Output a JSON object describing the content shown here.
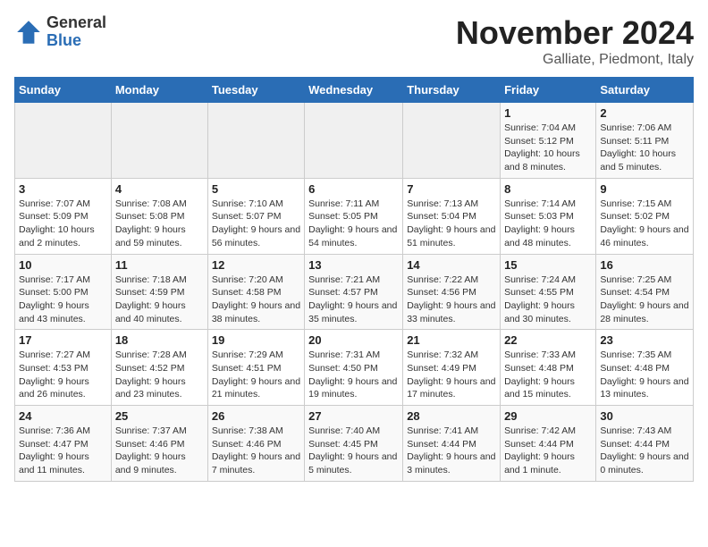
{
  "logo": {
    "general": "General",
    "blue": "Blue"
  },
  "header": {
    "month": "November 2024",
    "location": "Galliate, Piedmont, Italy"
  },
  "weekdays": [
    "Sunday",
    "Monday",
    "Tuesday",
    "Wednesday",
    "Thursday",
    "Friday",
    "Saturday"
  ],
  "weeks": [
    [
      {
        "day": "",
        "info": ""
      },
      {
        "day": "",
        "info": ""
      },
      {
        "day": "",
        "info": ""
      },
      {
        "day": "",
        "info": ""
      },
      {
        "day": "",
        "info": ""
      },
      {
        "day": "1",
        "info": "Sunrise: 7:04 AM\nSunset: 5:12 PM\nDaylight: 10 hours and 8 minutes."
      },
      {
        "day": "2",
        "info": "Sunrise: 7:06 AM\nSunset: 5:11 PM\nDaylight: 10 hours and 5 minutes."
      }
    ],
    [
      {
        "day": "3",
        "info": "Sunrise: 7:07 AM\nSunset: 5:09 PM\nDaylight: 10 hours and 2 minutes."
      },
      {
        "day": "4",
        "info": "Sunrise: 7:08 AM\nSunset: 5:08 PM\nDaylight: 9 hours and 59 minutes."
      },
      {
        "day": "5",
        "info": "Sunrise: 7:10 AM\nSunset: 5:07 PM\nDaylight: 9 hours and 56 minutes."
      },
      {
        "day": "6",
        "info": "Sunrise: 7:11 AM\nSunset: 5:05 PM\nDaylight: 9 hours and 54 minutes."
      },
      {
        "day": "7",
        "info": "Sunrise: 7:13 AM\nSunset: 5:04 PM\nDaylight: 9 hours and 51 minutes."
      },
      {
        "day": "8",
        "info": "Sunrise: 7:14 AM\nSunset: 5:03 PM\nDaylight: 9 hours and 48 minutes."
      },
      {
        "day": "9",
        "info": "Sunrise: 7:15 AM\nSunset: 5:02 PM\nDaylight: 9 hours and 46 minutes."
      }
    ],
    [
      {
        "day": "10",
        "info": "Sunrise: 7:17 AM\nSunset: 5:00 PM\nDaylight: 9 hours and 43 minutes."
      },
      {
        "day": "11",
        "info": "Sunrise: 7:18 AM\nSunset: 4:59 PM\nDaylight: 9 hours and 40 minutes."
      },
      {
        "day": "12",
        "info": "Sunrise: 7:20 AM\nSunset: 4:58 PM\nDaylight: 9 hours and 38 minutes."
      },
      {
        "day": "13",
        "info": "Sunrise: 7:21 AM\nSunset: 4:57 PM\nDaylight: 9 hours and 35 minutes."
      },
      {
        "day": "14",
        "info": "Sunrise: 7:22 AM\nSunset: 4:56 PM\nDaylight: 9 hours and 33 minutes."
      },
      {
        "day": "15",
        "info": "Sunrise: 7:24 AM\nSunset: 4:55 PM\nDaylight: 9 hours and 30 minutes."
      },
      {
        "day": "16",
        "info": "Sunrise: 7:25 AM\nSunset: 4:54 PM\nDaylight: 9 hours and 28 minutes."
      }
    ],
    [
      {
        "day": "17",
        "info": "Sunrise: 7:27 AM\nSunset: 4:53 PM\nDaylight: 9 hours and 26 minutes."
      },
      {
        "day": "18",
        "info": "Sunrise: 7:28 AM\nSunset: 4:52 PM\nDaylight: 9 hours and 23 minutes."
      },
      {
        "day": "19",
        "info": "Sunrise: 7:29 AM\nSunset: 4:51 PM\nDaylight: 9 hours and 21 minutes."
      },
      {
        "day": "20",
        "info": "Sunrise: 7:31 AM\nSunset: 4:50 PM\nDaylight: 9 hours and 19 minutes."
      },
      {
        "day": "21",
        "info": "Sunrise: 7:32 AM\nSunset: 4:49 PM\nDaylight: 9 hours and 17 minutes."
      },
      {
        "day": "22",
        "info": "Sunrise: 7:33 AM\nSunset: 4:48 PM\nDaylight: 9 hours and 15 minutes."
      },
      {
        "day": "23",
        "info": "Sunrise: 7:35 AM\nSunset: 4:48 PM\nDaylight: 9 hours and 13 minutes."
      }
    ],
    [
      {
        "day": "24",
        "info": "Sunrise: 7:36 AM\nSunset: 4:47 PM\nDaylight: 9 hours and 11 minutes."
      },
      {
        "day": "25",
        "info": "Sunrise: 7:37 AM\nSunset: 4:46 PM\nDaylight: 9 hours and 9 minutes."
      },
      {
        "day": "26",
        "info": "Sunrise: 7:38 AM\nSunset: 4:46 PM\nDaylight: 9 hours and 7 minutes."
      },
      {
        "day": "27",
        "info": "Sunrise: 7:40 AM\nSunset: 4:45 PM\nDaylight: 9 hours and 5 minutes."
      },
      {
        "day": "28",
        "info": "Sunrise: 7:41 AM\nSunset: 4:44 PM\nDaylight: 9 hours and 3 minutes."
      },
      {
        "day": "29",
        "info": "Sunrise: 7:42 AM\nSunset: 4:44 PM\nDaylight: 9 hours and 1 minute."
      },
      {
        "day": "30",
        "info": "Sunrise: 7:43 AM\nSunset: 4:44 PM\nDaylight: 9 hours and 0 minutes."
      }
    ]
  ]
}
